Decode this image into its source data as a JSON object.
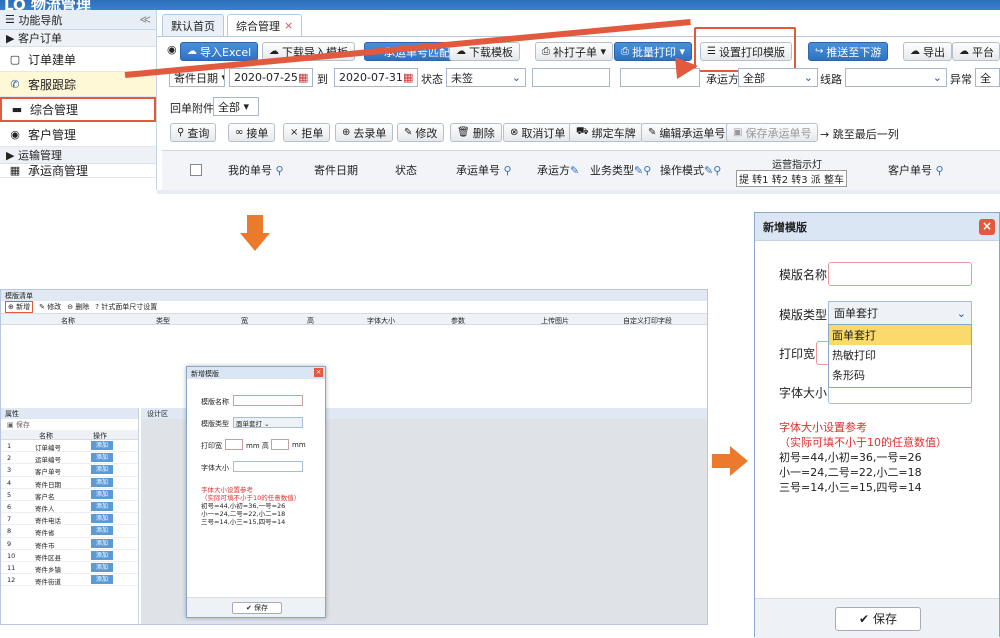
{
  "app": {
    "logo": "LO 物流管理"
  },
  "nav": {
    "header": "功能导航",
    "collapse": "≪",
    "groups": [
      {
        "label": "客户订单"
      },
      {
        "label": "运输管理"
      }
    ],
    "items": [
      {
        "label": "订单建单"
      },
      {
        "label": "客服跟踪"
      },
      {
        "label": "综合管理"
      },
      {
        "label": "客户管理"
      },
      {
        "label": "承运商管理"
      }
    ]
  },
  "tabs": [
    {
      "label": "默认首页"
    },
    {
      "label": "综合管理",
      "close": "×"
    }
  ],
  "toolbar1": {
    "import_excel": "导入Excel",
    "download_template": "下载导入模板",
    "match_carrier_no": "承运单号匹配",
    "download_template2": "下载模板",
    "reprint": "补打子单",
    "batch_print": "批量打印",
    "set_print_template": "设置打印模版",
    "push_downstream": "推送至下游",
    "export": "导出",
    "platform": "平台"
  },
  "filters": {
    "date_type": "寄件日期",
    "date_from": "2020-07-25",
    "to": "到",
    "date_to": "2020-07-31",
    "status_label": "状态",
    "status_value": "未签",
    "carrier_label": "承运方",
    "carrier_value": "全部",
    "route_label": "线路",
    "route_value": "",
    "abnormal_label": "异常",
    "abnormal_value": "全",
    "receipt_label": "回单附件",
    "receipt_value": "全部"
  },
  "toolbar2": {
    "query": "查询",
    "accept": "接单",
    "reject": "拒单",
    "pickup": "去录单",
    "edit": "修改",
    "delete": "删除",
    "cancel_order": "取消订单",
    "bind_plate": "绑定车牌",
    "edit_carrier_no": "编辑承运单号",
    "save_carrier_no": "保存承运单号",
    "jump_last": "跳至最后一列"
  },
  "grid": {
    "columns": [
      "我的单号",
      "寄件日期",
      "状态",
      "承运单号",
      "承运方",
      "业务类型",
      "操作模式",
      "客户单号"
    ],
    "ops_light": "运营指示灯",
    "lights": "提 转1 转2 转3 派 整车"
  },
  "template_list": {
    "title": "模版清单",
    "new": "新增",
    "edit": "修改",
    "delete": "删除",
    "needle": "针式面单尺寸设置",
    "cols": [
      "名称",
      "类型",
      "宽",
      "高",
      "字体大小",
      "参数",
      "上传图片",
      "自定义打印字段"
    ]
  },
  "props": {
    "title": "属性",
    "save": "保存",
    "col_name": "名称",
    "col_op": "操作",
    "design": "设计区",
    "add": "添加",
    "rows": [
      {
        "n": "1",
        "name": "订单编号"
      },
      {
        "n": "2",
        "name": "运单编号"
      },
      {
        "n": "3",
        "name": "客户单号"
      },
      {
        "n": "4",
        "name": "寄件日期"
      },
      {
        "n": "5",
        "name": "客户名"
      },
      {
        "n": "6",
        "name": "寄件人"
      },
      {
        "n": "7",
        "name": "寄件电话"
      },
      {
        "n": "8",
        "name": "寄件省"
      },
      {
        "n": "9",
        "name": "寄件市"
      },
      {
        "n": "10",
        "name": "寄件区县"
      },
      {
        "n": "11",
        "name": "寄件乡镇"
      },
      {
        "n": "12",
        "name": "寄件街道"
      }
    ]
  },
  "dialog": {
    "title": "新增模版",
    "name_label": "模版名称",
    "type_label": "模版类型",
    "type_value": "面单套打",
    "options": [
      "面单套打",
      "热敏打印",
      "条形码"
    ],
    "width_label": "打印宽",
    "mm": "mm",
    "height_label": "高",
    "font_label": "字体大小",
    "ref_title": "字体大小设置参考",
    "ref_sub": "（实际可填不小于10的任意数值）",
    "ref_1": "初号=44,小初=36,一号=26",
    "ref_2": "小一=24,二号=22,小二=18",
    "ref_3": "三号=14,小三=15,四号=14",
    "save": "保存"
  }
}
